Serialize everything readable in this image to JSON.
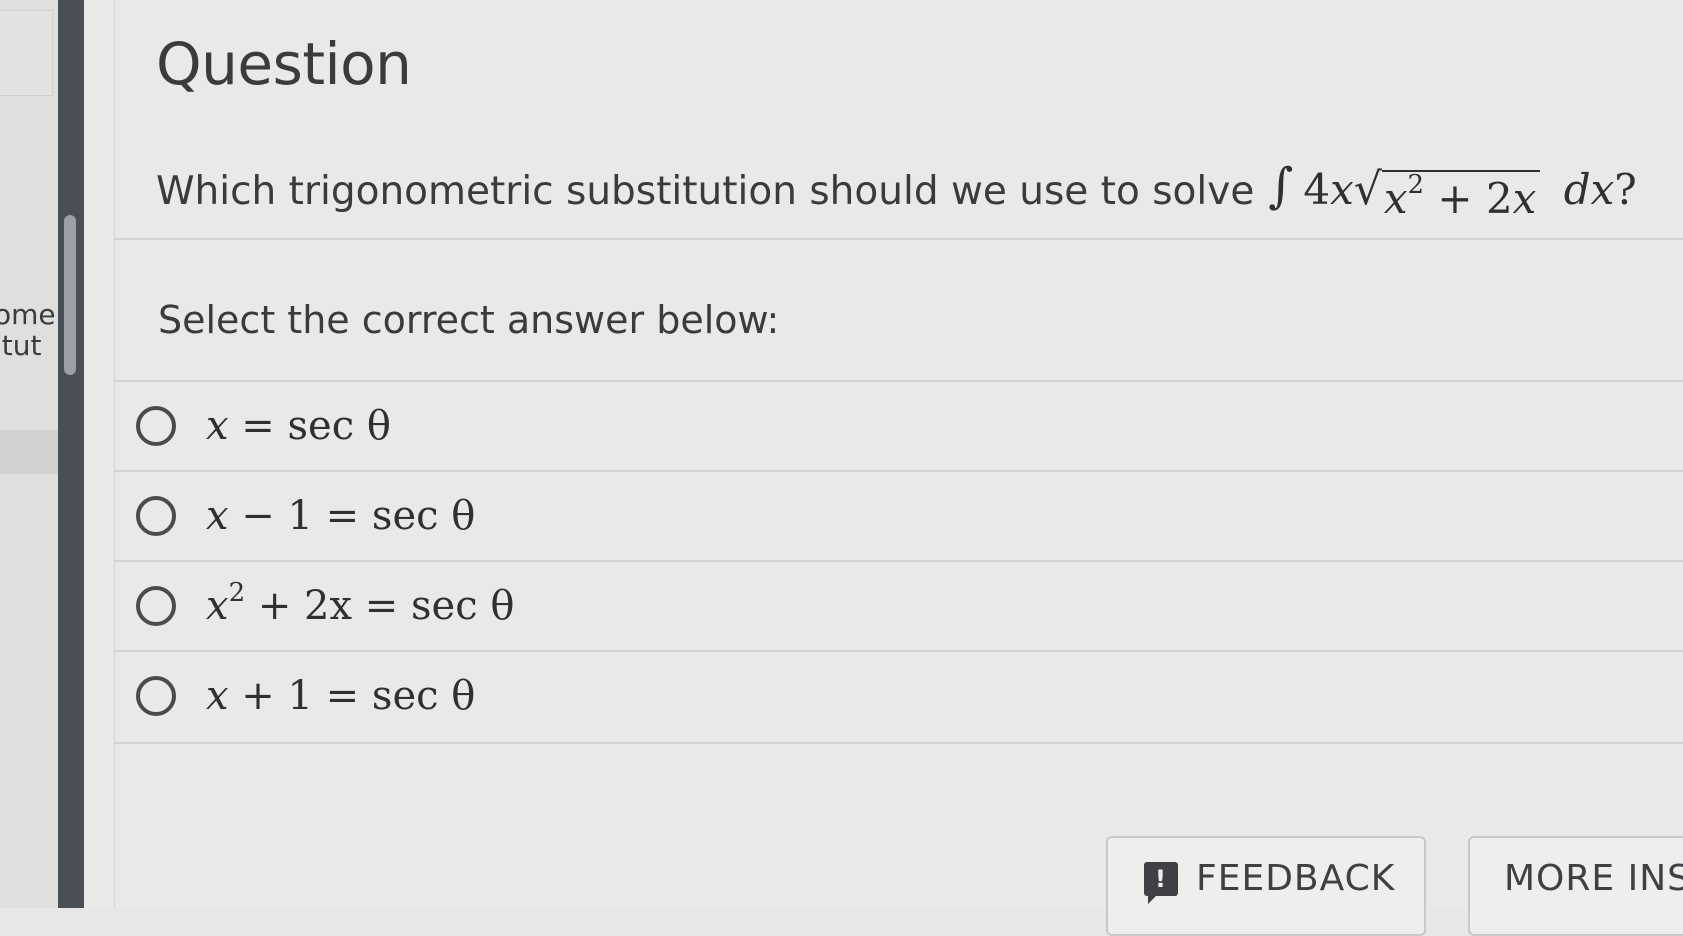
{
  "left_panel": {
    "line1": "ome",
    "line2": "itut"
  },
  "page": {
    "title": "Question"
  },
  "question": {
    "prompt_text": "Which trigonometric substitution should we use to solve",
    "integral_sign": "∫",
    "coef": "4",
    "var": "x",
    "radicand_base": "x",
    "radicand_exp": "2",
    "radicand_rest": " + 2",
    "radicand_var": "x",
    "differential": "dx",
    "end": "?"
  },
  "instructions": "Select the correct answer below:",
  "options": [
    {
      "lhs_var": "x",
      "lhs_rest": "",
      "rhs": " = sec θ"
    },
    {
      "lhs_var": "x",
      "lhs_rest": " − 1",
      "rhs": " = sec θ"
    },
    {
      "lhs_var": "x",
      "lhs_exp": "2",
      "lhs_rest": " + 2x",
      "rhs": " = sec θ"
    },
    {
      "lhs_var": "x",
      "lhs_rest": " + 1",
      "rhs": " = sec θ"
    }
  ],
  "buttons": {
    "feedback_icon": "!",
    "feedback_label": "FEEDBACK",
    "more_label": "MORE INS"
  }
}
